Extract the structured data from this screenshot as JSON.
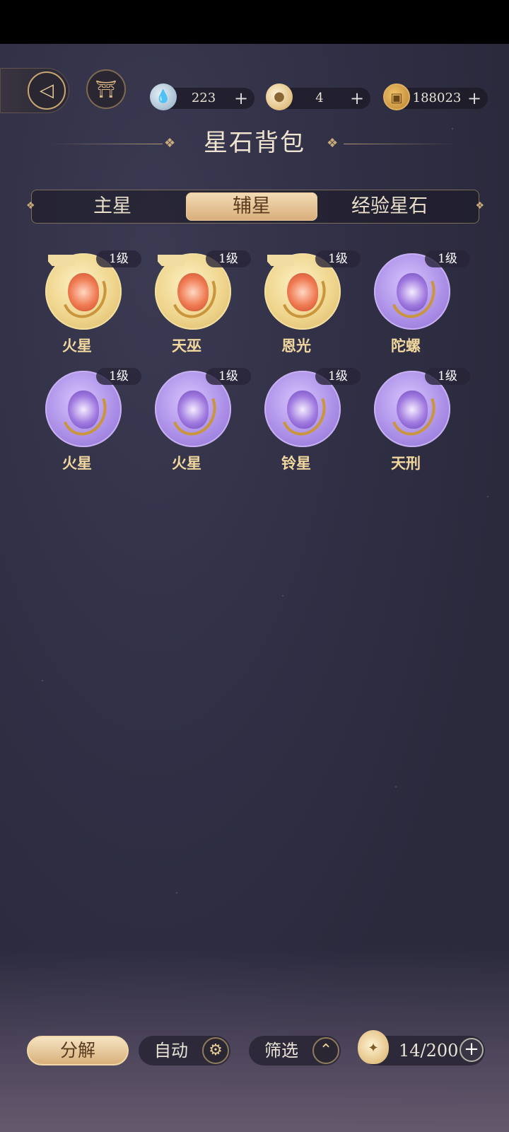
{
  "header": {
    "back_icon": "back-arrow-icon",
    "home_icon": "pavilion-icon",
    "title": "星石背包"
  },
  "currencies": [
    {
      "icon": "water-drop-icon",
      "value": "223",
      "plus": "+"
    },
    {
      "icon": "money-bag-icon",
      "value": "4",
      "plus": "+"
    },
    {
      "icon": "copper-coin-icon",
      "value": "188023",
      "plus": "+"
    }
  ],
  "tabs": [
    {
      "label": "主星",
      "active": false
    },
    {
      "label": "辅星",
      "active": true
    },
    {
      "label": "经验星石",
      "active": false
    }
  ],
  "items": [
    {
      "name": "火星",
      "level": "1级",
      "rarity": "gold",
      "flag": true
    },
    {
      "name": "天巫",
      "level": "1级",
      "rarity": "gold",
      "flag": true
    },
    {
      "name": "恩光",
      "level": "1级",
      "rarity": "gold",
      "flag": true
    },
    {
      "name": "陀螺",
      "level": "1级",
      "rarity": "purple",
      "flag": false
    },
    {
      "name": "火星",
      "level": "1级",
      "rarity": "purple",
      "flag": false
    },
    {
      "name": "火星",
      "level": "1级",
      "rarity": "purple",
      "flag": false
    },
    {
      "name": "铃星",
      "level": "1级",
      "rarity": "purple",
      "flag": false
    },
    {
      "name": "天刑",
      "level": "1级",
      "rarity": "purple",
      "flag": false
    }
  ],
  "bottom": {
    "decompose_label": "分解",
    "auto_label": "自动",
    "auto_icon": "gear-icon",
    "filter_label": "筛选",
    "filter_icon": "chevron-up-icon",
    "capacity_icon": "bag-icon",
    "capacity": "14/200",
    "add_icon": "plus-icon"
  },
  "colors": {
    "background": "#302f45",
    "accent_gold": "#d8ae7a",
    "name_text": "#f0d79e"
  }
}
